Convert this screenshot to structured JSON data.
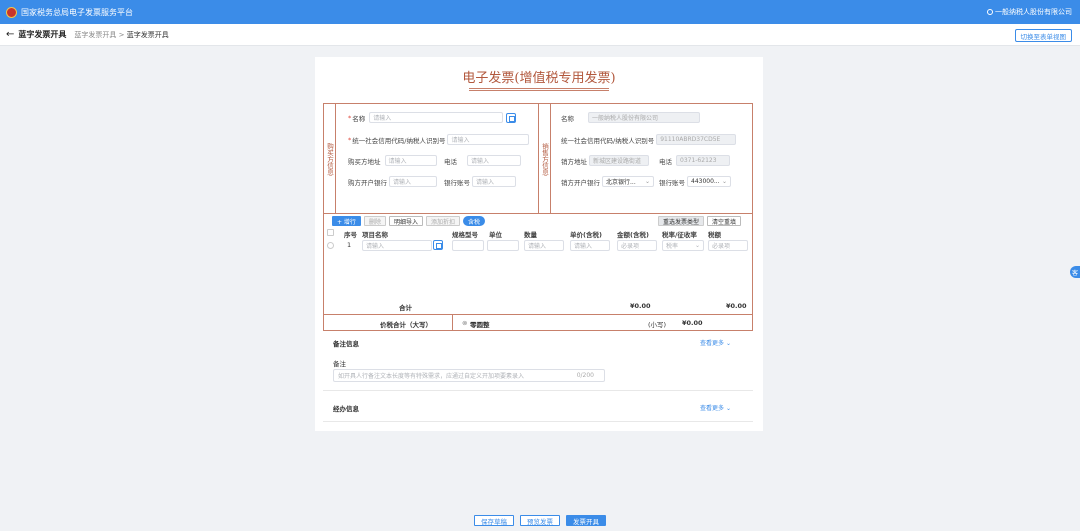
{
  "header": {
    "platform": "国家税务总局电子发票服务平台",
    "user": "一般纳税人股份有限公司",
    "user_icon": "user-icon"
  },
  "subheader": {
    "back_icon": "back-arrow-icon",
    "title": "蓝字发票开具",
    "crumb1": "蓝字发票开具",
    "crumb_sep": ">",
    "crumb2": "蓝字发票开具",
    "switch_label": "切换至表单视图"
  },
  "invoice": {
    "title": "电子发票(增值税专用发票)"
  },
  "buyer": {
    "section_label": "购买方信息",
    "name_label": "名称",
    "name_ph": "请输入",
    "taxid_label": "统一社会信用代码/纳税人识别号",
    "taxid_ph": "请输入",
    "addr_label": "购买方地址",
    "addr_ph": "请输入",
    "phone_label": "电话",
    "phone_ph": "请输入",
    "bank_label": "购方开户银行",
    "bank_ph": "请输入",
    "acct_label": "银行账号",
    "acct_ph": "请输入"
  },
  "seller": {
    "section_label": "销售方信息",
    "name_label": "名称",
    "name_val": "一般纳税人股份有限公司",
    "taxid_label": "统一社会信用代码/纳税人识别号",
    "taxid_val": "91110ABRD37CD5E",
    "addr_label": "销方地址",
    "addr_val": "新城区建设路街道",
    "phone_label": "电话",
    "phone_val": "0371-62123",
    "bank_label": "销方开户银行",
    "bank_val": "北京银行...",
    "acct_label": "银行账号",
    "acct_val": "443000..."
  },
  "toolbar": {
    "add": "+ 增行",
    "delete": "删除",
    "import": "明细导入",
    "discount": "添加折扣",
    "tax_toggle": "含税",
    "reselect": "重选发票类型",
    "clear": "清空重填"
  },
  "table": {
    "headers": [
      "序号",
      "项目名称",
      "规格型号",
      "单位",
      "数量",
      "单价(含税)",
      "金额(含税)",
      "税率/征收率",
      "税额"
    ],
    "row": {
      "no": "1",
      "name_ph": "请输入",
      "qty_ph": "请输入",
      "price_ph": "请输入",
      "amount_ph": "必录项",
      "rate_ph": "税率",
      "tax_ph": "必录项"
    },
    "sum_label": "合计",
    "sum_amount": "¥0.00",
    "sum_tax": "¥0.00",
    "total_label": "价税合计（大写）",
    "total_words": "零圆整",
    "total_small_label": "(小写)",
    "total_small": "¥0.00"
  },
  "remarks": {
    "section": "备注信息",
    "more": "查看更多",
    "label": "备注",
    "ph": "如开具人行备注文本长度等有特殊需求，应通过自定义开加项要素录入",
    "count": "0/200"
  },
  "operator": {
    "section": "经办信息",
    "more": "查看更多"
  },
  "actions": {
    "save": "保存草稿",
    "preview": "预览发票",
    "issue": "发票开具"
  },
  "float_label": "客"
}
